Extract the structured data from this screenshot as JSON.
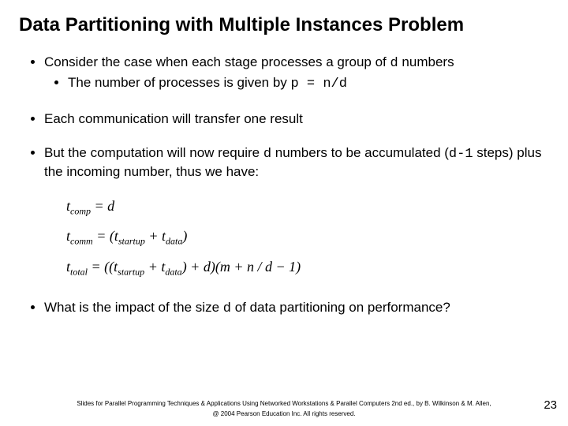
{
  "title": "Data Partitioning with Multiple Instances Problem",
  "bullets": {
    "b1_a": "Consider the case when each stage processes a group of ",
    "b1_d": "d",
    "b1_b": " numbers",
    "b1s_a": "The number of processes is given by ",
    "b1s_code": "p = n/d",
    "b2": "Each communication will transfer one result",
    "b3_a": "But the computation will now require ",
    "b3_d": "d",
    "b3_b": " numbers to be accumulated (",
    "b3_code": "d-1",
    "b3_c": " steps) plus the incoming number, thus we have:",
    "b4_a": "What is the impact of the size ",
    "b4_d": "d",
    "b4_b": "  of data partitioning on performance?"
  },
  "eq": {
    "e1_l": "t",
    "e1_sub": "comp",
    "e1_r": " = d",
    "e2_l": "t",
    "e2_sub": "comm",
    "e2_mid": " = (t",
    "e2_s1": "startup",
    "e2_plus": " + t",
    "e2_s2": "data",
    "e2_end": ")",
    "e3_l": "t",
    "e3_sub": "total",
    "e3_a": " = ((t",
    "e3_s1": "startup",
    "e3_b": " + t",
    "e3_s2": "data",
    "e3_c": ") + d)(m + n / d − 1)"
  },
  "footer": {
    "line1": "Slides for Parallel Programming Techniques & Applications Using Networked Workstations & Parallel Computers 2nd ed., by B. Wilkinson & M. Allen,",
    "line2": "@ 2004 Pearson Education Inc. All rights reserved."
  },
  "page": "23"
}
